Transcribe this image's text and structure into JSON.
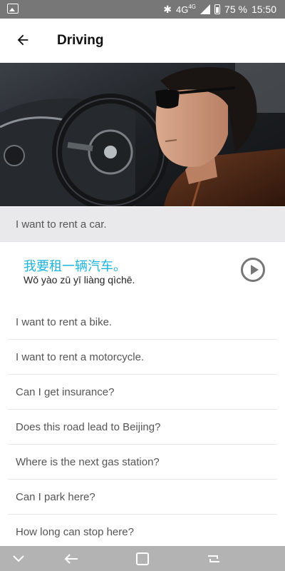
{
  "status_bar": {
    "network": "4G",
    "network_sup": "4G",
    "battery": "75 %",
    "time": "15:50"
  },
  "header": {
    "title": "Driving"
  },
  "hero_image": {
    "description_icon": "man-in-car-photo"
  },
  "phrases": [
    {
      "text": "I want to rent a car.",
      "state": "selected"
    },
    {
      "text": "I want to rent a bike."
    },
    {
      "text": "I want to rent a motorcycle."
    },
    {
      "text": "Can I get insurance?"
    },
    {
      "text": "Does this road lead to Beijing?"
    },
    {
      "text": "Where is the next gas station?"
    },
    {
      "text": "Can I park here?"
    },
    {
      "text": "How long can stop here?"
    }
  ],
  "selected_translation": {
    "chinese": "我要租一辆汽车。",
    "pinyin": "Wǒ yào zū yī liàng qìchē."
  },
  "colors": {
    "accent": "#1fb4dc",
    "status_bar": "#777777",
    "nav_bar": "#b3b3b3",
    "selected_row": "#e9e9ec"
  }
}
